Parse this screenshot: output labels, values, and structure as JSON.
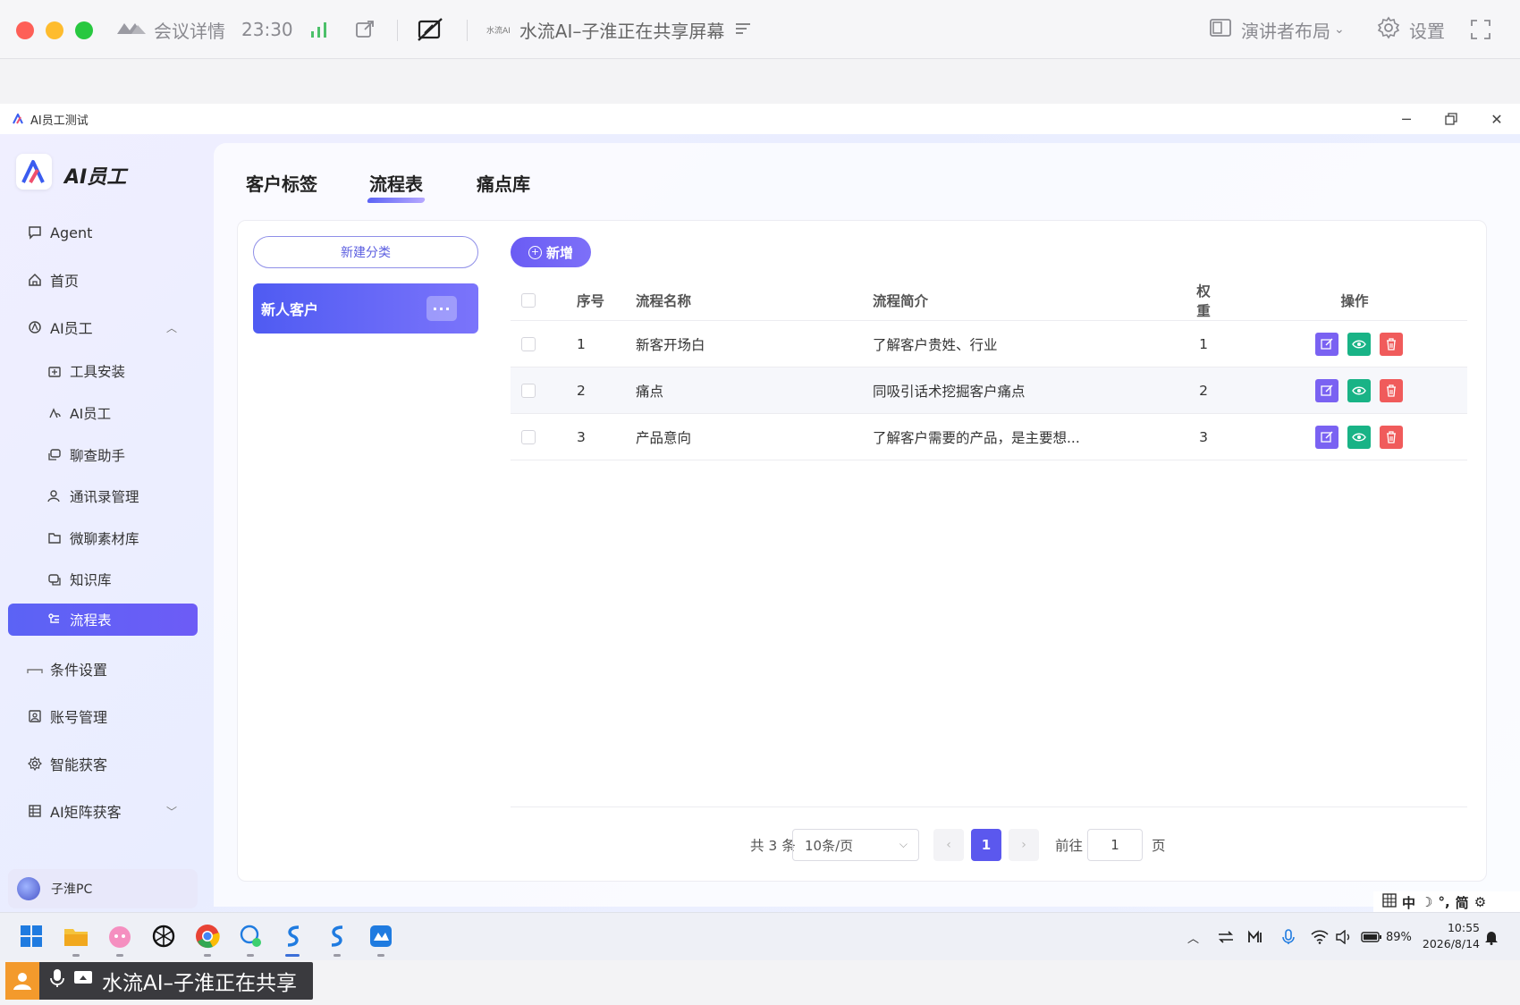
{
  "meeting": {
    "details_label": "会议详情",
    "timer": "23:30",
    "share_brand": "水流AI",
    "share_title": "水流AI–子淮正在共享屏幕",
    "layout_label": "演讲者布局",
    "settings_label": "设置"
  },
  "window": {
    "title": "AI员工测试"
  },
  "sidebar": {
    "brand": "AI员工",
    "items": [
      {
        "label": "Agent",
        "icon": "chat-icon"
      },
      {
        "label": "首页",
        "icon": "home-icon"
      },
      {
        "label": "AI员工",
        "icon": "ai-icon"
      },
      {
        "label": "工具安装",
        "icon": "tool-icon"
      },
      {
        "label": "AI员工",
        "icon": "ai-icon"
      },
      {
        "label": "聊查助手",
        "icon": "assistant-icon"
      },
      {
        "label": "通讯录管理",
        "icon": "contacts-icon"
      },
      {
        "label": "微聊素材库",
        "icon": "folder-icon"
      },
      {
        "label": "知识库",
        "icon": "knowledge-icon"
      },
      {
        "label": "流程表",
        "icon": "flow-icon"
      },
      {
        "label": "条件设置",
        "icon": "condition-icon"
      },
      {
        "label": "账号管理",
        "icon": "account-icon"
      },
      {
        "label": "智能获客",
        "icon": "gear-icon"
      },
      {
        "label": "AI矩阵获客",
        "icon": "matrix-icon"
      }
    ],
    "user": "子淮PC"
  },
  "tabs": [
    "客户标签",
    "流程表",
    "痛点库"
  ],
  "category": {
    "new_label": "新建分类",
    "items": [
      "新人客户"
    ],
    "more_label": "···"
  },
  "toolbar": {
    "add_label": "新增"
  },
  "table": {
    "headers": [
      "序号",
      "流程名称",
      "流程简介",
      "权重",
      "操作"
    ],
    "rows": [
      {
        "idx": "1",
        "name": "新客开场白",
        "desc": "了解客户贵姓、行业",
        "weight": "1"
      },
      {
        "idx": "2",
        "name": "痛点",
        "desc": "同吸引话术挖掘客户痛点",
        "weight": "2"
      },
      {
        "idx": "3",
        "name": "产品意向",
        "desc": "了解客户需要的产品，是主要想...",
        "weight": "3"
      }
    ]
  },
  "pagination": {
    "total": "共 3 条",
    "page_size": "10条/页",
    "current": "1",
    "goto_label": "前往",
    "goto_value": "1",
    "page_suffix": "页"
  },
  "ime": {
    "chars": [
      "中",
      "简"
    ]
  },
  "taskbar": {
    "battery": "89%",
    "time": "10:55",
    "date": "2026/8/14"
  },
  "share_banner": {
    "text": "水流AI–子淮正在共享"
  },
  "colors": {
    "accent": "#5b63f5",
    "edit": "#7a62f2",
    "view": "#19b386",
    "delete": "#f05b5b"
  }
}
